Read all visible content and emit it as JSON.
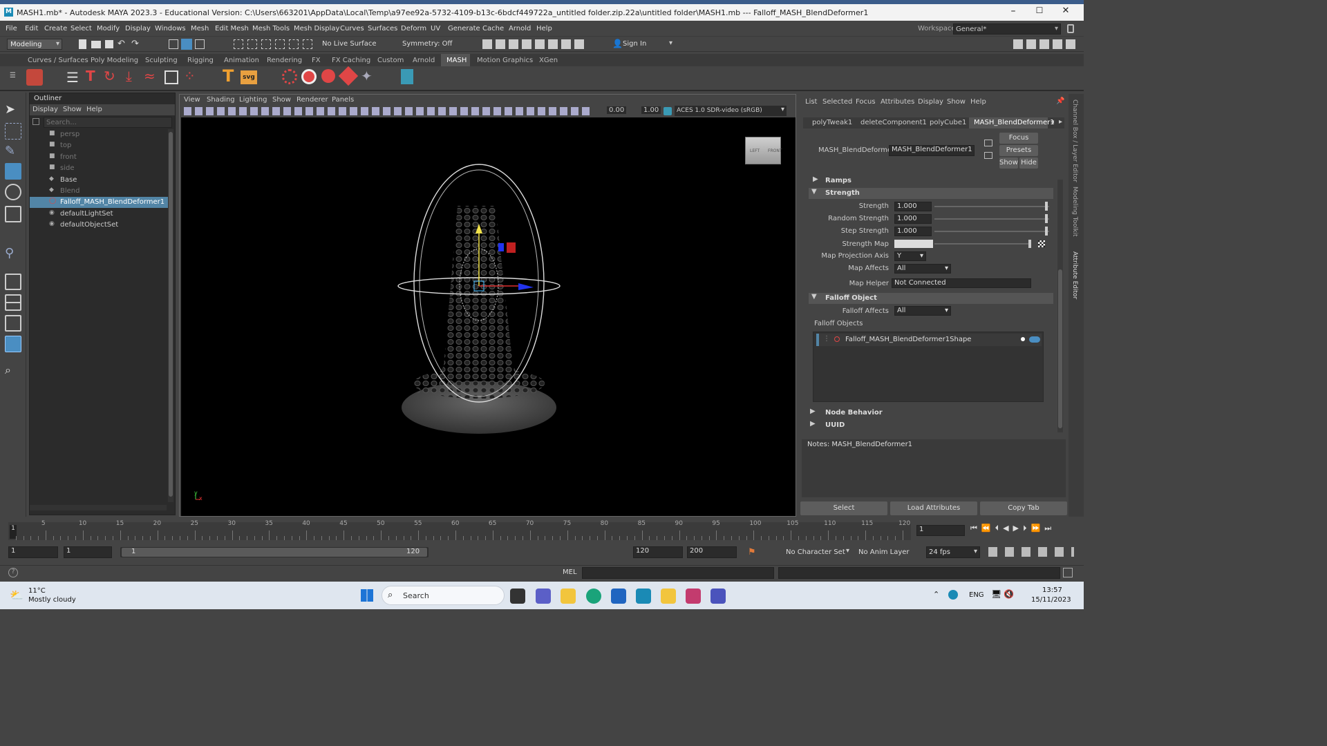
{
  "window": {
    "title": "MASH1.mb* - Autodesk MAYA 2023.3 - Educational Version: C:\\Users\\663201\\AppData\\Local\\Temp\\a97ee92a-5732-4109-b13c-6bdcf449722a_untitled folder.zip.22a\\untitled folder\\MASH1.mb  ---  Falloff_MASH_BlendDeformer1"
  },
  "menubar": {
    "items": [
      "File",
      "Edit",
      "Create",
      "Select",
      "Modify",
      "Display",
      "Windows",
      "Mesh",
      "Edit Mesh",
      "Mesh Tools",
      "Mesh Display",
      "Curves",
      "Surfaces",
      "Deform",
      "UV",
      "Generate",
      "Cache",
      "Arnold",
      "Help"
    ],
    "workspace_label": "Workspace:",
    "workspace_value": "General*"
  },
  "statusline": {
    "mode": "Modeling",
    "live_surface": "No Live Surface",
    "symmetry": "Symmetry: Off",
    "sign_in": "Sign In"
  },
  "shelf": {
    "tabs": [
      "Curves / Surfaces",
      "Poly Modeling",
      "Sculpting",
      "Rigging",
      "Animation",
      "Rendering",
      "FX",
      "FX Caching",
      "Custom",
      "Arnold",
      "MASH",
      "Motion Graphics",
      "XGen"
    ],
    "active_tab": "MASH"
  },
  "outliner": {
    "title": "Outliner",
    "menu": [
      "Display",
      "Show",
      "Help"
    ],
    "search_placeholder": "Search...",
    "items": [
      {
        "label": "persp",
        "icon": "camera-icon",
        "dim": true
      },
      {
        "label": "top",
        "icon": "camera-icon",
        "dim": true
      },
      {
        "label": "front",
        "icon": "camera-icon",
        "dim": true
      },
      {
        "label": "side",
        "icon": "camera-icon",
        "dim": true
      },
      {
        "label": "Base",
        "icon": "transform-icon",
        "dim": false
      },
      {
        "label": "Blend",
        "icon": "transform-icon",
        "dim": true
      },
      {
        "label": "Falloff_MASH_BlendDeformer1",
        "icon": "falloff-icon",
        "dim": false,
        "selected": true
      },
      {
        "label": "defaultLightSet",
        "icon": "set-icon",
        "dim": false
      },
      {
        "label": "defaultObjectSet",
        "icon": "set-icon",
        "dim": false
      }
    ]
  },
  "viewport": {
    "menu": [
      "View",
      "Shading",
      "Lighting",
      "Show",
      "Renderer",
      "Panels"
    ],
    "field_a": "0.00",
    "field_b": "1.00",
    "color_space": "ACES 1.0 SDR-video (sRGB)",
    "viewcube_left": "LEFT",
    "viewcube_front": "FRONT",
    "axis_y": "y",
    "axis_x": "x"
  },
  "attribute_editor": {
    "menu": [
      "List",
      "Selected",
      "Focus",
      "Attributes",
      "Display",
      "Show",
      "Help"
    ],
    "tabs": [
      "polyTweak1",
      "deleteComponent1",
      "polyCube1",
      "MASH_BlendDeformer1"
    ],
    "node_label": "MASH_BlendDeformer:",
    "node_value": "MASH_BlendDeformer1",
    "buttons": {
      "focus": "Focus",
      "presets": "Presets",
      "show": "Show",
      "hide": "Hide"
    },
    "sections": {
      "ramps": "Ramps",
      "strength": "Strength",
      "falloff_object": "Falloff Object",
      "node_behavior": "Node Behavior",
      "uuid": "UUID"
    },
    "strength": {
      "label": "Strength",
      "value": "1.000",
      "fill": 1.0
    },
    "random_strength": {
      "label": "Random Strength",
      "value": "1.000",
      "fill": 1.0
    },
    "step_strength": {
      "label": "Step Strength",
      "value": "1.000",
      "fill": 1.0
    },
    "strength_map": {
      "label": "Strength Map"
    },
    "map_projection_axis": {
      "label": "Map Projection Axis",
      "value": "Y"
    },
    "map_affects": {
      "label": "Map Affects",
      "value": "All"
    },
    "map_helper": {
      "label": "Map Helper",
      "value": "Not Connected"
    },
    "falloff_affects": {
      "label": "Falloff Affects",
      "value": "All"
    },
    "falloff_objects_label": "Falloff Objects",
    "falloff_object_item": "Falloff_MASH_BlendDeformer1Shape",
    "notes": "Notes:  MASH_BlendDeformer1",
    "bottom_buttons": {
      "select": "Select",
      "load": "Load Attributes",
      "copy": "Copy Tab"
    }
  },
  "side_tabs": [
    "Channel Box / Layer Editor",
    "Modeling Toolkit",
    "Attribute Editor"
  ],
  "timeline": {
    "ticks": [
      "5",
      "10",
      "15",
      "20",
      "25",
      "30",
      "35",
      "40",
      "45",
      "50",
      "55",
      "60",
      "65",
      "70",
      "75",
      "80",
      "85",
      "90",
      "95",
      "100",
      "105",
      "110",
      "115",
      "120"
    ],
    "current_frame": "1",
    "start_marker": "1"
  },
  "rangebar": {
    "start": "1",
    "anim_start": "1",
    "range_start": "1",
    "range_end": "120",
    "anim_end": "120",
    "end": "200",
    "character_set": "No Character Set",
    "anim_layer": "No Anim Layer",
    "fps": "24 fps"
  },
  "cmdline": {
    "lang": "MEL"
  },
  "taskbar": {
    "weather_temp": "11°C",
    "weather_desc": "Mostly cloudy",
    "search": "Search",
    "lang": "ENG",
    "time": "13:57",
    "date": "15/11/2023"
  },
  "colors": {
    "selection": "#5285a6",
    "maya_blue": "#1a8ab5",
    "highlight_tool": "#4a8ec2"
  }
}
